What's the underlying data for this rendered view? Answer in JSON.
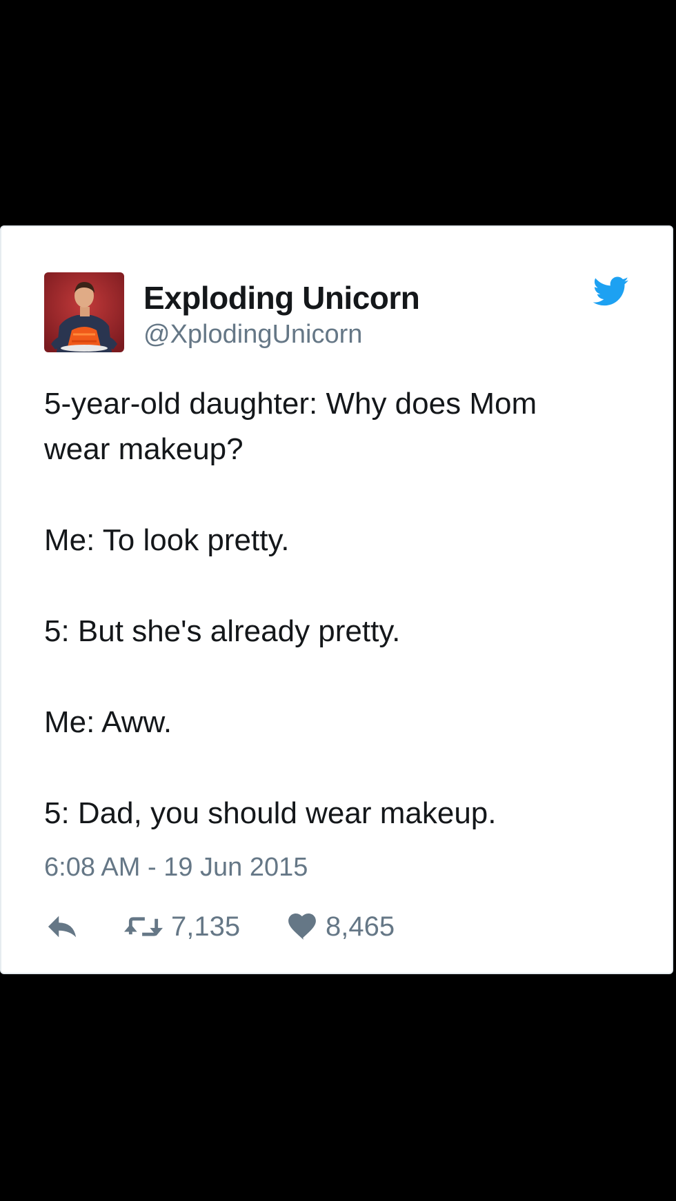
{
  "tweet": {
    "author": {
      "display_name": "Exploding Unicorn",
      "handle": "@XplodingUnicorn"
    },
    "text_lines": [
      "5-year-old daughter: Why does Mom wear makeup?",
      "Me: To look pretty.",
      "5: But she's already pretty.",
      "Me: Aww.",
      "5: Dad, you should wear makeup."
    ],
    "timestamp": "6:08 AM - 19 Jun 2015",
    "stats": {
      "retweets": "7,135",
      "likes": "8,465"
    }
  },
  "icons": {
    "brand": "twitter-bird-icon",
    "reply": "reply-arrow-icon",
    "retweet": "retweet-icon",
    "like": "heart-icon"
  },
  "colors": {
    "background": "#000000",
    "card": "#ffffff",
    "text": "#14171a",
    "secondary_text": "#657786",
    "twitter_blue": "#1da1f2"
  }
}
